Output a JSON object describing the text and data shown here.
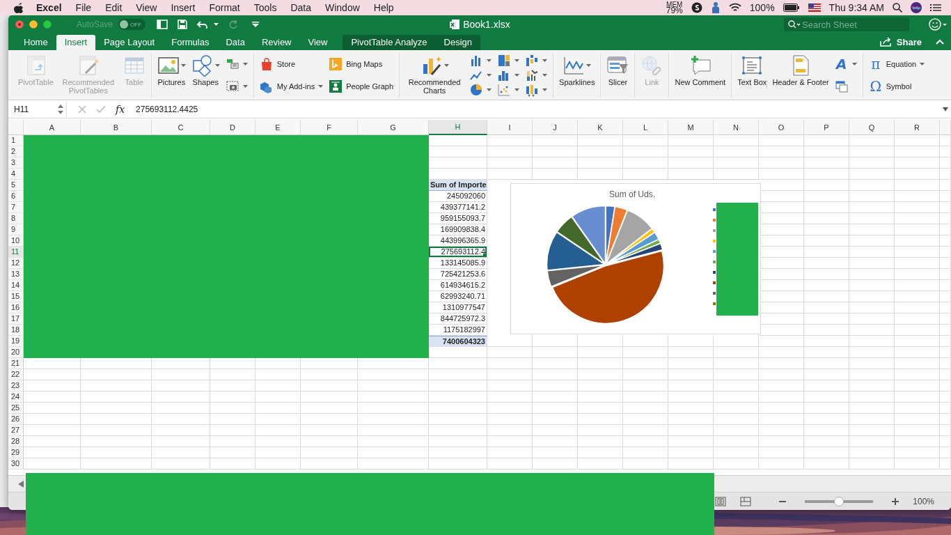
{
  "menu_bar": {
    "app": "Excel",
    "items": [
      "File",
      "Edit",
      "View",
      "Insert",
      "Format",
      "Tools",
      "Data",
      "Window",
      "Help"
    ],
    "mem_label": "MEM",
    "mem_value": "79%",
    "battery": "100%",
    "clock": "Thu 9:34 AM"
  },
  "window": {
    "title": "Book1.xlsx",
    "autosave_label": "AutoSave",
    "autosave": {
      "on": false,
      "text": "OFF"
    },
    "search_placeholder": "Search Sheet"
  },
  "tabs": [
    {
      "label": "Home",
      "selected": false,
      "kind": "standard"
    },
    {
      "label": "Insert",
      "selected": true,
      "kind": "standard"
    },
    {
      "label": "Page Layout",
      "selected": false,
      "kind": "standard"
    },
    {
      "label": "Formulas",
      "selected": false,
      "kind": "standard"
    },
    {
      "label": "Data",
      "selected": false,
      "kind": "standard"
    },
    {
      "label": "Review",
      "selected": false,
      "kind": "standard"
    },
    {
      "label": "View",
      "selected": false,
      "kind": "standard"
    },
    {
      "label": "PivotTable Analyze",
      "selected": false,
      "kind": "contextual"
    },
    {
      "label": "Design",
      "selected": false,
      "kind": "contextual"
    }
  ],
  "share": "Share",
  "ribbon": [
    {
      "cols": [
        {
          "kind": "large",
          "items": [
            {
              "label": "PivotTable",
              "disabled": true,
              "dropdown": false
            }
          ]
        },
        {
          "kind": "large",
          "items": [
            {
              "label": "Recommended PivotTables",
              "disabled": true,
              "dropdown": false
            }
          ]
        },
        {
          "kind": "large",
          "items": [
            {
              "label": "Table",
              "disabled": true,
              "dropdown": false
            }
          ]
        }
      ]
    },
    {
      "cols": [
        {
          "kind": "large",
          "items": [
            {
              "label": "Pictures",
              "disabled": false,
              "dropdown": true
            }
          ]
        },
        {
          "kind": "large",
          "items": [
            {
              "label": "Shapes",
              "disabled": false,
              "dropdown": true
            }
          ]
        },
        {
          "kind": "stack",
          "items": [
            {
              "disabled": false,
              "dropdown": true
            },
            {
              "disabled": false,
              "dropdown": true
            }
          ]
        }
      ]
    },
    {
      "cols": [
        {
          "kind": "stack",
          "items": [
            {
              "label": "Store",
              "disabled": false,
              "dropdown": false
            },
            {
              "label": "My Add-ins",
              "disabled": false,
              "dropdown": true
            }
          ]
        },
        {
          "kind": "stack",
          "items": [
            {
              "label": "Bing Maps",
              "disabled": false,
              "dropdown": false
            },
            {
              "label": "People Graph",
              "disabled": false,
              "dropdown": false
            }
          ]
        }
      ]
    },
    {
      "cols": [
        {
          "kind": "large",
          "items": [
            {
              "label": "Recommended Charts",
              "disabled": false,
              "dropdown": true
            }
          ]
        },
        {
          "kind": "stack",
          "items": [
            {
              "disabled": false,
              "dropdown": true
            },
            {
              "disabled": false,
              "dropdown": true
            },
            {
              "disabled": false,
              "dropdown": true
            }
          ]
        },
        {
          "kind": "stack",
          "items": [
            {
              "disabled": false,
              "dropdown": true
            },
            {
              "disabled": false,
              "dropdown": true
            },
            {
              "disabled": false,
              "dropdown": true
            }
          ]
        },
        {
          "kind": "stack",
          "items": [
            {
              "disabled": false,
              "dropdown": true
            },
            {
              "disabled": false,
              "dropdown": true
            },
            {
              "disabled": false,
              "dropdown": true
            }
          ]
        }
      ]
    },
    {
      "cols": [
        {
          "kind": "large",
          "items": [
            {
              "label": "Sparklines",
              "disabled": false,
              "dropdown": true
            }
          ]
        }
      ]
    },
    {
      "cols": [
        {
          "kind": "large",
          "items": [
            {
              "label": "Slicer",
              "disabled": false,
              "dropdown": false
            }
          ]
        }
      ]
    },
    {
      "cols": [
        {
          "kind": "large",
          "items": [
            {
              "label": "Link",
              "disabled": true,
              "dropdown": false
            }
          ]
        }
      ]
    },
    {
      "cols": [
        {
          "kind": "large",
          "items": [
            {
              "label": "New Comment",
              "disabled": false,
              "dropdown": false
            }
          ]
        }
      ]
    },
    {
      "cols": [
        {
          "kind": "large",
          "items": [
            {
              "label": "Text Box",
              "disabled": false,
              "dropdown": false
            }
          ]
        },
        {
          "kind": "large",
          "items": [
            {
              "label": "Header & Footer",
              "disabled": false,
              "dropdown": false
            }
          ]
        },
        {
          "kind": "stack",
          "items": [
            {
              "glyph": "A",
              "disabled": false,
              "dropdown": true
            },
            {
              "disabled": false,
              "dropdown": false
            }
          ]
        }
      ]
    },
    {
      "cols": [
        {
          "kind": "stack",
          "items": [
            {
              "glyph": "π",
              "label": "Equation",
              "disabled": false,
              "dropdown": true
            },
            {
              "glyph": "Ω",
              "label": "Symbol",
              "disabled": false,
              "dropdown": false
            }
          ]
        }
      ]
    }
  ],
  "formula_bar": {
    "name_box": "H11",
    "fx": "fx",
    "value": "275693112.4425"
  },
  "sheet": {
    "columns": [
      {
        "label": "A",
        "selected": false
      },
      {
        "label": "B",
        "selected": false
      },
      {
        "label": "C",
        "selected": false
      },
      {
        "label": "D",
        "selected": false
      },
      {
        "label": "E",
        "selected": false
      },
      {
        "label": "F",
        "selected": false
      },
      {
        "label": "G",
        "selected": false
      },
      {
        "label": "H",
        "selected": true
      },
      {
        "label": "I",
        "selected": false
      },
      {
        "label": "J",
        "selected": false
      },
      {
        "label": "K",
        "selected": false
      },
      {
        "label": "L",
        "selected": false
      },
      {
        "label": "M",
        "selected": false
      },
      {
        "label": "N",
        "selected": false
      },
      {
        "label": "O",
        "selected": false
      },
      {
        "label": "P",
        "selected": false
      },
      {
        "label": "Q",
        "selected": false
      },
      {
        "label": "R",
        "selected": false
      }
    ],
    "rows": [
      {
        "label": "1",
        "selected": false
      },
      {
        "label": "2",
        "selected": false
      },
      {
        "label": "3",
        "selected": false
      },
      {
        "label": "4",
        "selected": false
      },
      {
        "label": "5",
        "selected": false
      },
      {
        "label": "6",
        "selected": false
      },
      {
        "label": "7",
        "selected": false
      },
      {
        "label": "8",
        "selected": false
      },
      {
        "label": "9",
        "selected": false
      },
      {
        "label": "10",
        "selected": false
      },
      {
        "label": "11",
        "selected": true
      },
      {
        "label": "12",
        "selected": false
      },
      {
        "label": "13",
        "selected": false
      },
      {
        "label": "14",
        "selected": false
      },
      {
        "label": "15",
        "selected": false
      },
      {
        "label": "16",
        "selected": false
      },
      {
        "label": "17",
        "selected": false
      },
      {
        "label": "18",
        "selected": false
      },
      {
        "label": "19",
        "selected": false
      },
      {
        "label": "20",
        "selected": false
      },
      {
        "label": "21",
        "selected": false
      },
      {
        "label": "22",
        "selected": false
      },
      {
        "label": "23",
        "selected": false
      },
      {
        "label": "24",
        "selected": false
      },
      {
        "label": "25",
        "selected": false
      },
      {
        "label": "26",
        "selected": false
      },
      {
        "label": "27",
        "selected": false
      },
      {
        "label": "28",
        "selected": false
      },
      {
        "label": "29",
        "selected": false
      },
      {
        "label": "30",
        "selected": false
      }
    ],
    "pivot": {
      "header": "Sum of Importe",
      "values": [
        {
          "text": "245092060",
          "selected": false
        },
        {
          "text": "439377141.2",
          "selected": false
        },
        {
          "text": "959155093.7",
          "selected": false
        },
        {
          "text": "169909838.4",
          "selected": false
        },
        {
          "text": "443996365.9",
          "selected": false
        },
        {
          "text": "275693112.4",
          "selected": true
        },
        {
          "text": "133145085.9",
          "selected": false
        },
        {
          "text": "725421253.6",
          "selected": false
        },
        {
          "text": "614934615.2",
          "selected": false
        },
        {
          "text": "62993240.71",
          "selected": false
        },
        {
          "text": "1310977547",
          "selected": false
        },
        {
          "text": "844725972.3",
          "selected": false
        },
        {
          "text": "1175182997",
          "selected": false
        }
      ],
      "total": "7400604323"
    }
  },
  "chart": {
    "title": "Sum of Uds.",
    "legend": [
      {
        "color": "#4472c4"
      },
      {
        "color": "#ed7d31"
      },
      {
        "color": "#a5a5a5"
      },
      {
        "color": "#ffc000"
      },
      {
        "color": "#5b9bd5"
      },
      {
        "color": "#70ad47"
      },
      {
        "color": "#264478"
      },
      {
        "color": "#9e480e"
      },
      {
        "color": "#636363"
      },
      {
        "color": "#997300"
      }
    ]
  },
  "status_bar": {
    "zoom": {
      "level": 0.5,
      "text": "100%"
    }
  }
}
